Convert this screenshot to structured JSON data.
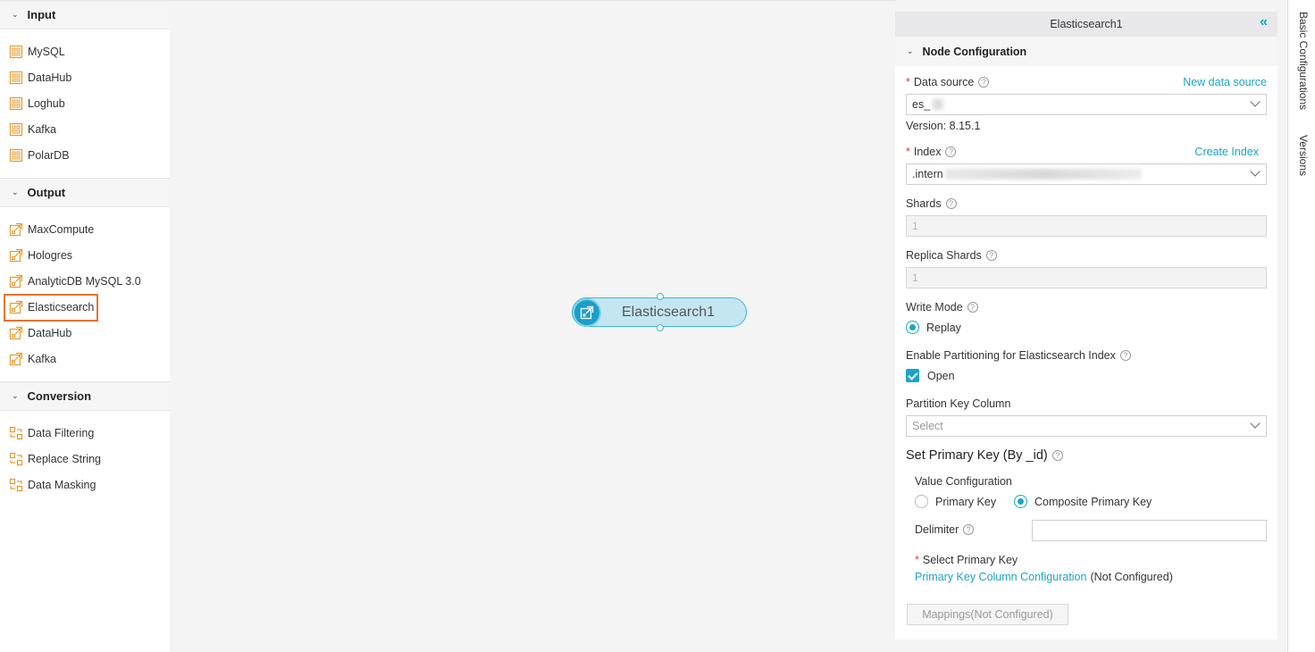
{
  "palette": {
    "groups": [
      {
        "title": "Input",
        "items": [
          "MySQL",
          "DataHub",
          "Loghub",
          "Kafka",
          "PolarDB"
        ]
      },
      {
        "title": "Output",
        "items": [
          "MaxCompute",
          "Hologres",
          "AnalyticDB MySQL 3.0",
          "Elasticsearch",
          "DataHub",
          "Kafka"
        ]
      },
      {
        "title": "Conversion",
        "items": [
          "Data Filtering",
          "Replace String",
          "Data Masking"
        ]
      }
    ],
    "selected_item": "Elasticsearch"
  },
  "canvas": {
    "node_label": "Elasticsearch1"
  },
  "panel": {
    "title": "Elasticsearch1",
    "section": "Node Configuration",
    "data_source": {
      "label": "Data source",
      "link": "New data source",
      "value": "es_"
    },
    "version": "Version: 8.15.1",
    "index": {
      "label": "Index",
      "link": "Create Index",
      "value": ".intern"
    },
    "shards": {
      "label": "Shards",
      "value": "1"
    },
    "replica_shards": {
      "label": "Replica Shards",
      "value": "1"
    },
    "write_mode": {
      "label": "Write Mode",
      "option": "Replay"
    },
    "partitioning": {
      "label": "Enable Partitioning for Elasticsearch Index",
      "option": "Open"
    },
    "partition_key": {
      "label": "Partition Key Column",
      "placeholder": "Select"
    },
    "primary_key_section": "Set Primary Key (By _id)",
    "value_config": {
      "label": "Value Configuration",
      "option1": "Primary Key",
      "option2": "Composite Primary Key"
    },
    "delimiter": {
      "label": "Delimiter",
      "value": ""
    },
    "select_pk": {
      "label": "Select Primary Key",
      "link": "Primary Key Column Configuration",
      "status": "(Not Configured)"
    },
    "mappings_button": "Mappings(Not Configured)"
  },
  "side_tabs": [
    "Basic Configurations",
    "Versions"
  ],
  "colors": {
    "accent": "#1aa5c8",
    "selected_outline": "#e8732b",
    "required": "#e5393b"
  }
}
